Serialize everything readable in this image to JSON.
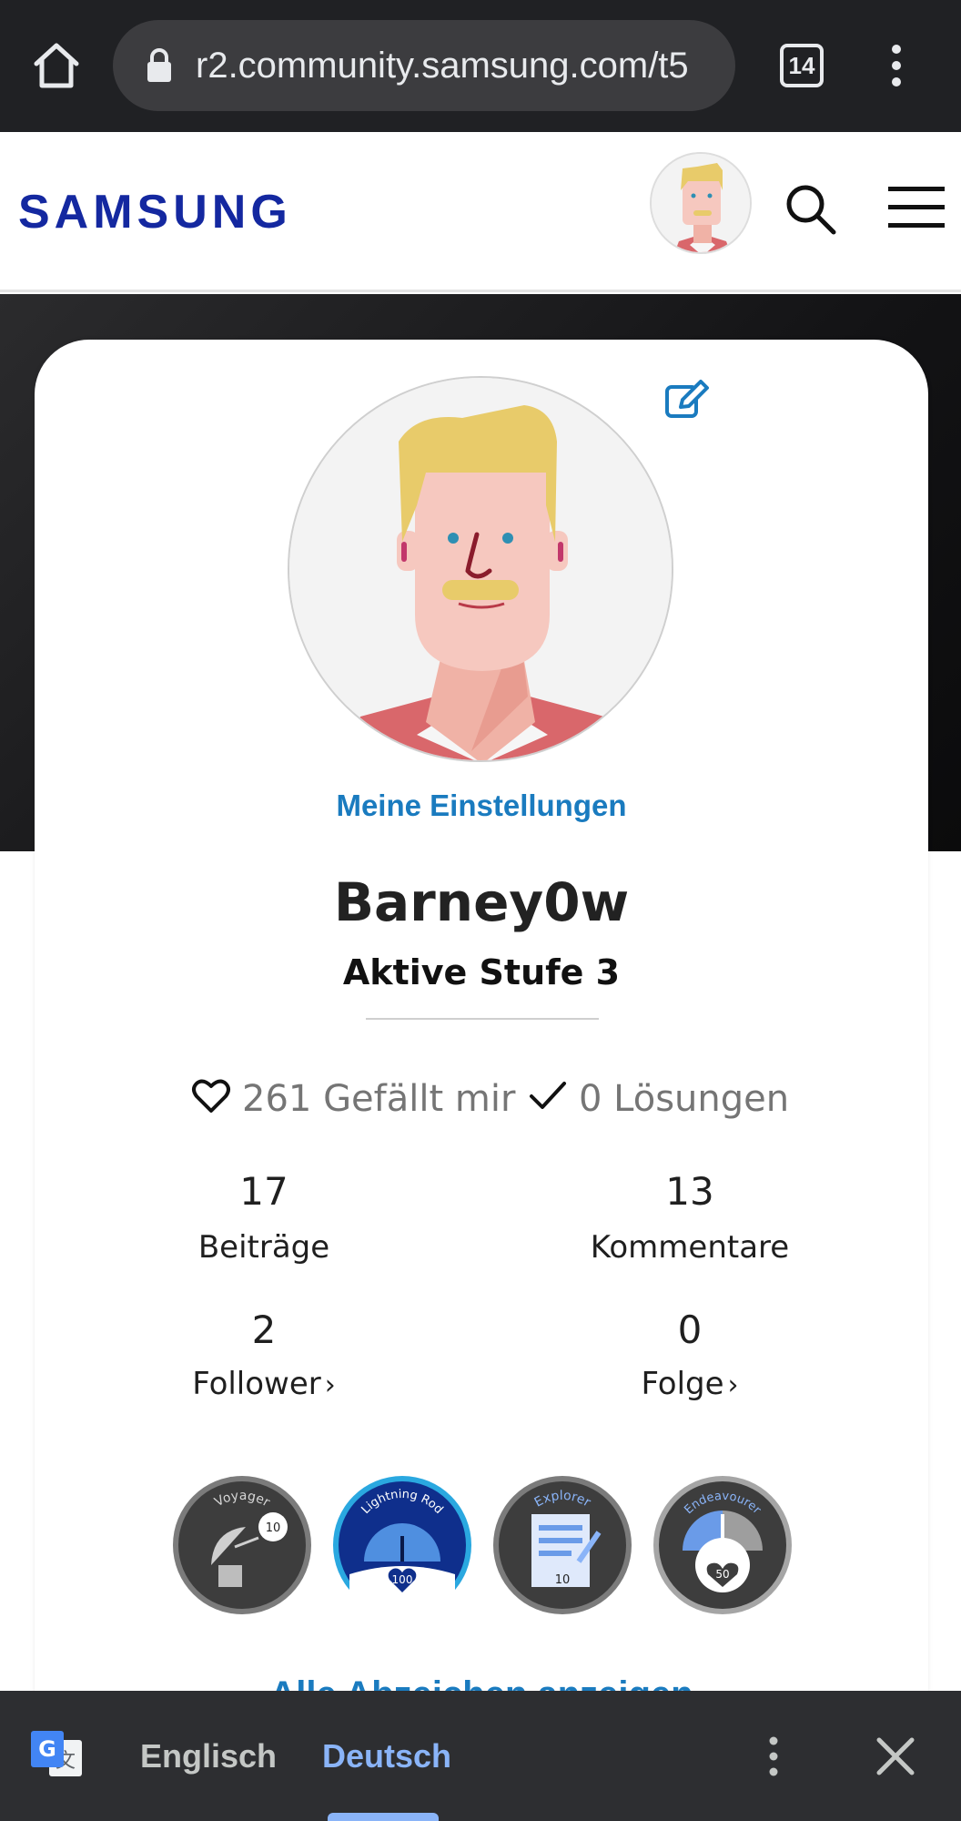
{
  "browser": {
    "url": "r2.community.samsung.com/t5",
    "tab_count": "14"
  },
  "site": {
    "logo": "SAMSUNG"
  },
  "profile": {
    "settings_link": "Meine Einstellungen",
    "username": "Barney0w",
    "level": "Aktive Stufe 3",
    "likes": "261 Gefällt mir",
    "solutions": "0 Lösungen",
    "stats": {
      "posts_count": "17",
      "posts_label": "Beiträge",
      "comments_count": "13",
      "comments_label": "Kommentare",
      "followers_count": "2",
      "followers_label": "Follower",
      "following_count": "0",
      "following_label": "Folge"
    },
    "badges": [
      {
        "title": "Voyager",
        "number": "10"
      },
      {
        "title": "Lightning Rod",
        "number": "100"
      },
      {
        "title": "Explorer",
        "number": "10"
      },
      {
        "title": "Endeavourer",
        "number": "50"
      }
    ],
    "all_badges_link": "Alle Abzeichen anzeigen"
  },
  "translate_bar": {
    "source_lang": "Englisch",
    "target_lang": "Deutsch"
  },
  "colors": {
    "brand": "#1428a0",
    "link": "#1a7bbf",
    "translate_active": "#8ab4f8"
  }
}
